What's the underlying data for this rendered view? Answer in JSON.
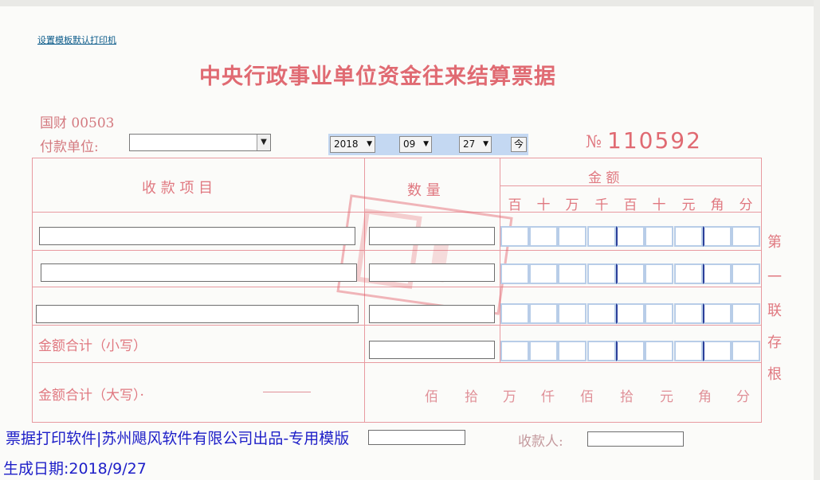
{
  "link": {
    "printer": "设置模板默认打印机"
  },
  "receipt": {
    "title": "中央行政事业单位资金往来结算票据",
    "code": "国财 00503",
    "payer_label": "付款单位:",
    "payer_value": "",
    "no_mark": "№",
    "number": "110592",
    "date": {
      "year": "2018",
      "month": "09",
      "day": "27",
      "today_btn": "今"
    }
  },
  "table": {
    "col_item": "收 款 项 目",
    "col_qty": "数  量",
    "col_amount": "金    额",
    "digits": [
      "百",
      "十",
      "万",
      "千",
      "百",
      "十",
      "元",
      "角",
      "分"
    ],
    "total_small_label": "金额合计（小写）",
    "total_big_label": "金额合计（大写）·",
    "big_units": [
      "佰",
      "拾",
      "万",
      "仟",
      "佰",
      "拾",
      "元",
      "角",
      "分"
    ]
  },
  "side_labels": [
    "第",
    "一",
    "联",
    "存",
    "根"
  ],
  "footer": {
    "text": "票据打印软件|苏州飓风软件有限公司出品-专用模版",
    "collector_label": "收款人:",
    "generated": "生成日期:2018/9/27"
  },
  "colors": {
    "accent_red": "#e06a72",
    "footer_blue": "#1d1ec8",
    "date_panel": "#c4d8f2"
  }
}
